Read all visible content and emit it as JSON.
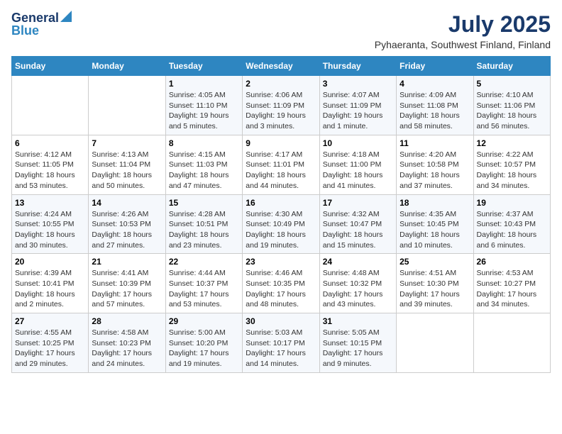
{
  "logo": {
    "general": "General",
    "blue": "Blue"
  },
  "title": "July 2025",
  "location": "Pyhaeranta, Southwest Finland, Finland",
  "weekdays": [
    "Sunday",
    "Monday",
    "Tuesday",
    "Wednesday",
    "Thursday",
    "Friday",
    "Saturday"
  ],
  "weeks": [
    [
      {
        "day": "",
        "info": ""
      },
      {
        "day": "",
        "info": ""
      },
      {
        "day": "1",
        "info": "Sunrise: 4:05 AM\nSunset: 11:10 PM\nDaylight: 19 hours\nand 5 minutes."
      },
      {
        "day": "2",
        "info": "Sunrise: 4:06 AM\nSunset: 11:09 PM\nDaylight: 19 hours\nand 3 minutes."
      },
      {
        "day": "3",
        "info": "Sunrise: 4:07 AM\nSunset: 11:09 PM\nDaylight: 19 hours\nand 1 minute."
      },
      {
        "day": "4",
        "info": "Sunrise: 4:09 AM\nSunset: 11:08 PM\nDaylight: 18 hours\nand 58 minutes."
      },
      {
        "day": "5",
        "info": "Sunrise: 4:10 AM\nSunset: 11:06 PM\nDaylight: 18 hours\nand 56 minutes."
      }
    ],
    [
      {
        "day": "6",
        "info": "Sunrise: 4:12 AM\nSunset: 11:05 PM\nDaylight: 18 hours\nand 53 minutes."
      },
      {
        "day": "7",
        "info": "Sunrise: 4:13 AM\nSunset: 11:04 PM\nDaylight: 18 hours\nand 50 minutes."
      },
      {
        "day": "8",
        "info": "Sunrise: 4:15 AM\nSunset: 11:03 PM\nDaylight: 18 hours\nand 47 minutes."
      },
      {
        "day": "9",
        "info": "Sunrise: 4:17 AM\nSunset: 11:01 PM\nDaylight: 18 hours\nand 44 minutes."
      },
      {
        "day": "10",
        "info": "Sunrise: 4:18 AM\nSunset: 11:00 PM\nDaylight: 18 hours\nand 41 minutes."
      },
      {
        "day": "11",
        "info": "Sunrise: 4:20 AM\nSunset: 10:58 PM\nDaylight: 18 hours\nand 37 minutes."
      },
      {
        "day": "12",
        "info": "Sunrise: 4:22 AM\nSunset: 10:57 PM\nDaylight: 18 hours\nand 34 minutes."
      }
    ],
    [
      {
        "day": "13",
        "info": "Sunrise: 4:24 AM\nSunset: 10:55 PM\nDaylight: 18 hours\nand 30 minutes."
      },
      {
        "day": "14",
        "info": "Sunrise: 4:26 AM\nSunset: 10:53 PM\nDaylight: 18 hours\nand 27 minutes."
      },
      {
        "day": "15",
        "info": "Sunrise: 4:28 AM\nSunset: 10:51 PM\nDaylight: 18 hours\nand 23 minutes."
      },
      {
        "day": "16",
        "info": "Sunrise: 4:30 AM\nSunset: 10:49 PM\nDaylight: 18 hours\nand 19 minutes."
      },
      {
        "day": "17",
        "info": "Sunrise: 4:32 AM\nSunset: 10:47 PM\nDaylight: 18 hours\nand 15 minutes."
      },
      {
        "day": "18",
        "info": "Sunrise: 4:35 AM\nSunset: 10:45 PM\nDaylight: 18 hours\nand 10 minutes."
      },
      {
        "day": "19",
        "info": "Sunrise: 4:37 AM\nSunset: 10:43 PM\nDaylight: 18 hours\nand 6 minutes."
      }
    ],
    [
      {
        "day": "20",
        "info": "Sunrise: 4:39 AM\nSunset: 10:41 PM\nDaylight: 18 hours\nand 2 minutes."
      },
      {
        "day": "21",
        "info": "Sunrise: 4:41 AM\nSunset: 10:39 PM\nDaylight: 17 hours\nand 57 minutes."
      },
      {
        "day": "22",
        "info": "Sunrise: 4:44 AM\nSunset: 10:37 PM\nDaylight: 17 hours\nand 53 minutes."
      },
      {
        "day": "23",
        "info": "Sunrise: 4:46 AM\nSunset: 10:35 PM\nDaylight: 17 hours\nand 48 minutes."
      },
      {
        "day": "24",
        "info": "Sunrise: 4:48 AM\nSunset: 10:32 PM\nDaylight: 17 hours\nand 43 minutes."
      },
      {
        "day": "25",
        "info": "Sunrise: 4:51 AM\nSunset: 10:30 PM\nDaylight: 17 hours\nand 39 minutes."
      },
      {
        "day": "26",
        "info": "Sunrise: 4:53 AM\nSunset: 10:27 PM\nDaylight: 17 hours\nand 34 minutes."
      }
    ],
    [
      {
        "day": "27",
        "info": "Sunrise: 4:55 AM\nSunset: 10:25 PM\nDaylight: 17 hours\nand 29 minutes."
      },
      {
        "day": "28",
        "info": "Sunrise: 4:58 AM\nSunset: 10:23 PM\nDaylight: 17 hours\nand 24 minutes."
      },
      {
        "day": "29",
        "info": "Sunrise: 5:00 AM\nSunset: 10:20 PM\nDaylight: 17 hours\nand 19 minutes."
      },
      {
        "day": "30",
        "info": "Sunrise: 5:03 AM\nSunset: 10:17 PM\nDaylight: 17 hours\nand 14 minutes."
      },
      {
        "day": "31",
        "info": "Sunrise: 5:05 AM\nSunset: 10:15 PM\nDaylight: 17 hours\nand 9 minutes."
      },
      {
        "day": "",
        "info": ""
      },
      {
        "day": "",
        "info": ""
      }
    ]
  ]
}
